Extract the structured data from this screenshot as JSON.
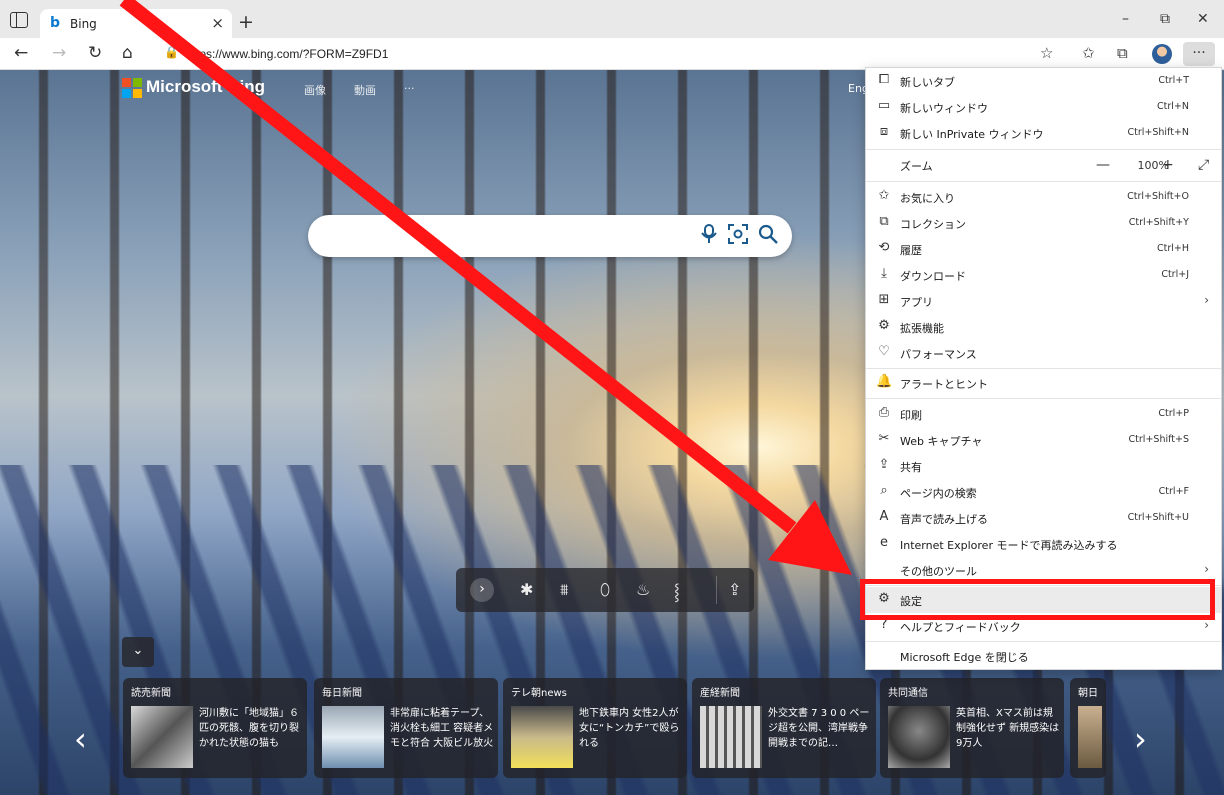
{
  "tab": {
    "title": "Bing",
    "favicon": "b",
    "close": "×"
  },
  "new_tab": "+",
  "window_controls": {
    "minimize": "–",
    "restore": "⧉",
    "close": "✕"
  },
  "nav": {
    "back": "←",
    "forward": "→",
    "refresh": "↻",
    "home": "⌂"
  },
  "address": {
    "url": "https://www.bing.com/?FORM=Z9FD1",
    "lock": "🔒"
  },
  "toolbar": {
    "favorites_add": "☆",
    "favorites": "✩",
    "collections": "⧉",
    "more": "···"
  },
  "bing": {
    "brand": "Microsoft Bing",
    "nav": [
      "画像",
      "動画",
      "···"
    ],
    "lang_link": "Eng",
    "search_placeholder": ""
  },
  "icon_strip": {
    "next": "›",
    "icons": [
      "✱",
      "⩩",
      "⬯",
      "♨",
      "⸾",
      "⇪"
    ]
  },
  "collapse": "⌄",
  "news_arrows": {
    "prev": "‹",
    "next": "›"
  },
  "news": [
    {
      "source": "読売新聞",
      "headline": "河川敷に「地域猫」６匹の死骸、腹を切り裂かれた状態の猫も"
    },
    {
      "source": "毎日新聞",
      "headline": "非常扉に粘着テープ、消火栓も細工 容疑者メモと符合 大阪ビル放火"
    },
    {
      "source": "テレ朝news",
      "headline": "地下鉄車内 女性2人が女に“トンカチ”で殴られる"
    },
    {
      "source": "産経新聞",
      "headline": "外交文書 7 3 0 0 ページ超を公開、湾岸戦争開戦までの記…"
    },
    {
      "source": "共同通信",
      "headline": "英首相、Xマス前は規制強化せず 新規感染は9万人"
    },
    {
      "source": "朝日",
      "headline": ""
    }
  ],
  "menu": {
    "items": [
      {
        "icon": "⧠",
        "label": "新しいタブ",
        "shortcut": "Ctrl+T"
      },
      {
        "icon": "▭",
        "label": "新しいウィンドウ",
        "shortcut": "Ctrl+N"
      },
      {
        "icon": "⧈",
        "label": "新しい InPrivate ウィンドウ",
        "shortcut": "Ctrl+Shift+N"
      },
      {
        "icon": "",
        "label": "ズーム",
        "shortcut": ""
      },
      {
        "icon": "✩",
        "label": "お気に入り",
        "shortcut": "Ctrl+Shift+O"
      },
      {
        "icon": "⧉",
        "label": "コレクション",
        "shortcut": "Ctrl+Shift+Y"
      },
      {
        "icon": "⟲",
        "label": "履歴",
        "shortcut": "Ctrl+H"
      },
      {
        "icon": "⤓",
        "label": "ダウンロード",
        "shortcut": "Ctrl+J"
      },
      {
        "icon": "⊞",
        "label": "アプリ",
        "shortcut": ""
      },
      {
        "icon": "⚙",
        "label": "拡張機能",
        "shortcut": ""
      },
      {
        "icon": "♡",
        "label": "パフォーマンス",
        "shortcut": ""
      },
      {
        "icon": "🔔",
        "label": "アラートとヒント",
        "shortcut": ""
      },
      {
        "icon": "⎙",
        "label": "印刷",
        "shortcut": "Ctrl+P"
      },
      {
        "icon": "✂",
        "label": "Web キャプチャ",
        "shortcut": "Ctrl+Shift+S"
      },
      {
        "icon": "⇪",
        "label": "共有",
        "shortcut": ""
      },
      {
        "icon": "⌕",
        "label": "ページ内の検索",
        "shortcut": "Ctrl+F"
      },
      {
        "icon": "A",
        "label": "音声で読み上げる",
        "shortcut": "Ctrl+Shift+U"
      },
      {
        "icon": "e",
        "label": "Internet Explorer モードで再読み込みする",
        "shortcut": ""
      },
      {
        "icon": "",
        "label": "その他のツール",
        "shortcut": ""
      },
      {
        "icon": "⚙",
        "label": "設定",
        "shortcut": ""
      },
      {
        "icon": "?",
        "label": "ヘルプとフィードバック",
        "shortcut": ""
      },
      {
        "icon": "",
        "label": "Microsoft Edge を閉じる",
        "shortcut": ""
      }
    ],
    "zoom": {
      "minus": "—",
      "value": "100%",
      "plus": "+",
      "fullscreen": "⤢"
    },
    "chevron": "›"
  },
  "colors": {
    "annotation_red": "#ff1515",
    "bing_blue": "#1b5a8c"
  }
}
